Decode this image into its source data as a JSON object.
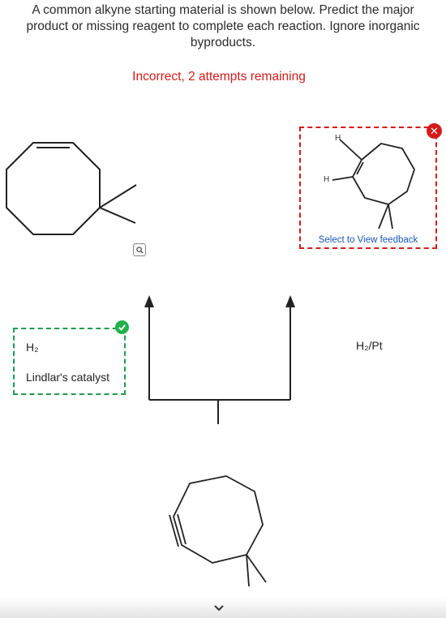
{
  "question": {
    "line1": "A common alkyne starting material is shown below. Predict the major",
    "line2": "product or missing reagent to complete each reaction. Ignore inorganic",
    "line3": "byproducts."
  },
  "status": "Incorrect, 2 attempts remaining",
  "product_box": {
    "feedback_label": "Select to View feedback",
    "atom_labels": [
      "H",
      "H"
    ]
  },
  "reagent_left": {
    "line1": "H₂",
    "line2": "Lindlar's catalyst"
  },
  "reagent_right": "H₂/Pt",
  "colors": {
    "error": "#d61a1a",
    "correct": "#1e9c4c",
    "bond": "#222222"
  },
  "icons": [
    "zoom-icon",
    "close-icon",
    "checkmark-icon",
    "chevron-down-icon"
  ]
}
